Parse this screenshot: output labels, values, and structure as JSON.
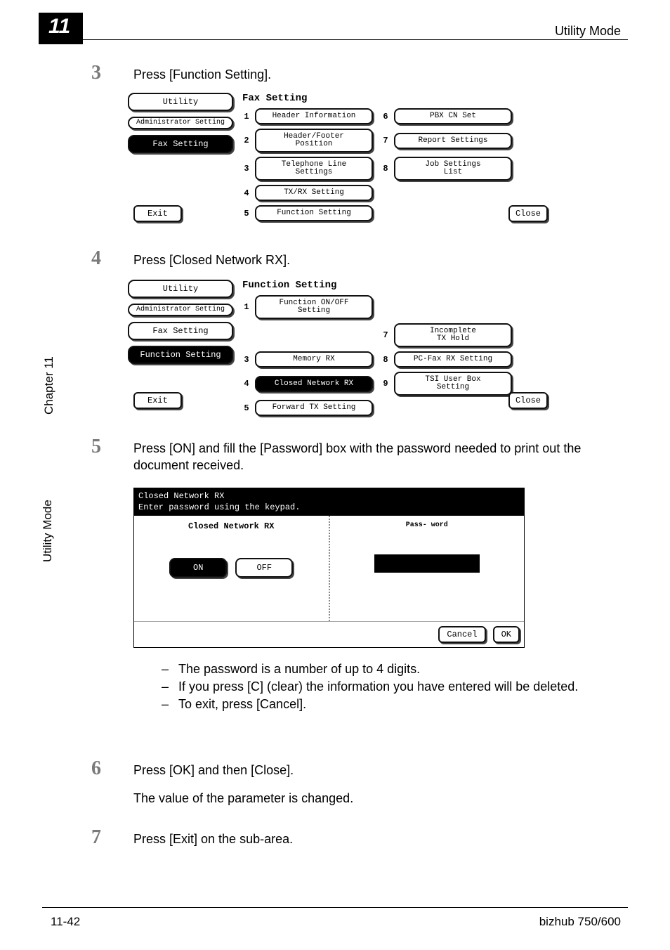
{
  "header": {
    "chapter": "11",
    "title": "Utility Mode"
  },
  "side": {
    "chapter": "Chapter 11",
    "section": "Utility Mode"
  },
  "common": {
    "exit": "Exit",
    "close": "Close"
  },
  "steps": [
    {
      "num": "3",
      "text": "Press [Function Setting]."
    },
    {
      "num": "4",
      "text": "Press [Closed Network RX]."
    },
    {
      "num": "5",
      "text": "Press [ON] and fill the [Password] box with the password needed to print out the document received."
    },
    {
      "num": "6",
      "text": "Press [OK] and then [Close].",
      "result": "The value of the parameter is changed."
    },
    {
      "num": "7",
      "text": "Press [Exit] on the sub-area."
    }
  ],
  "panel3": {
    "title": "Fax Setting",
    "side": [
      "Utility",
      "Administrator\nSetting",
      "Fax Setting"
    ],
    "items": [
      {
        "n": "1",
        "l": "Header Information"
      },
      {
        "n": "2",
        "l": "Header/Footer\nPosition"
      },
      {
        "n": "3",
        "l": "Telephone Line\nSettings"
      },
      {
        "n": "4",
        "l": "TX/RX Setting"
      },
      {
        "n": "5",
        "l": "Function Setting"
      },
      {
        "n": "6",
        "l": "PBX CN Set"
      },
      {
        "n": "7",
        "l": "Report Settings"
      },
      {
        "n": "8",
        "l": "Job Settings\nList"
      }
    ]
  },
  "panel4": {
    "title": "Function Setting",
    "side": [
      "Utility",
      "Administrator\nSetting",
      "Fax Setting",
      "Function Setting"
    ],
    "items": [
      {
        "n": "1",
        "l": "Function ON/OFF\nSetting"
      },
      {
        "n": "7",
        "l": "Incomplete\nTX Hold"
      },
      {
        "n": "3",
        "l": "Memory RX"
      },
      {
        "n": "8",
        "l": "PC-Fax RX Setting"
      },
      {
        "n": "4",
        "l": "Closed Network RX"
      },
      {
        "n": "9",
        "l": "TSI User Box\nSetting"
      },
      {
        "n": "5",
        "l": "Forward TX Setting"
      }
    ]
  },
  "dlg": {
    "title1": "Closed Network RX",
    "title2": "Enter password using the keypad.",
    "section_left": "Closed Network RX",
    "section_right": "Pass-\nword",
    "on": "ON",
    "off": "OFF",
    "cancel": "Cancel",
    "ok": "OK"
  },
  "notes": [
    "The password is a number of up to 4 digits.",
    "If you press [C] (clear) the information you have entered will be deleted.",
    "To exit, press [Cancel]."
  ],
  "footer": {
    "left": "11-42",
    "right": "bizhub 750/600"
  }
}
